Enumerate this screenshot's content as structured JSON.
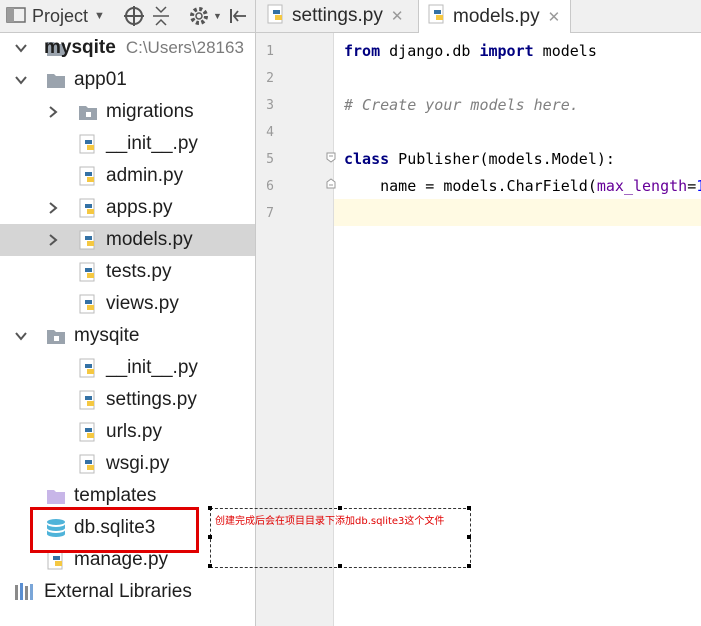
{
  "project_panel": {
    "switcher_label": "Project",
    "toolbar_icons": [
      "target-icon",
      "collapse-all-icon",
      "gear-icon",
      "hide-panel-icon"
    ]
  },
  "tree": [
    {
      "label": "mysqite",
      "path": "C:\\Users\\28163",
      "type": "project",
      "bold": true
    },
    {
      "label": "app01",
      "type": "folder",
      "expanded": true
    },
    {
      "label": "migrations",
      "type": "package",
      "expanded": false
    },
    {
      "label": "__init__.py",
      "type": "python"
    },
    {
      "label": "admin.py",
      "type": "python"
    },
    {
      "label": "apps.py",
      "type": "python",
      "expanded": false
    },
    {
      "label": "models.py",
      "type": "python",
      "expanded": false,
      "selected": true
    },
    {
      "label": "tests.py",
      "type": "python"
    },
    {
      "label": "views.py",
      "type": "python"
    },
    {
      "label": "mysqite",
      "type": "folder",
      "expanded": true
    },
    {
      "label": "__init__.py",
      "type": "python"
    },
    {
      "label": "settings.py",
      "type": "python"
    },
    {
      "label": "urls.py",
      "type": "python"
    },
    {
      "label": "wsgi.py",
      "type": "python"
    },
    {
      "label": "templates",
      "type": "template-folder"
    },
    {
      "label": "db.sqlite3",
      "type": "database"
    },
    {
      "label": "manage.py",
      "type": "python"
    },
    {
      "label": "External Libraries",
      "type": "libraries"
    }
  ],
  "tabs": [
    {
      "label": "settings.py",
      "close": "✕",
      "active": false
    },
    {
      "label": "models.py",
      "close": "✕",
      "active": true
    }
  ],
  "editor": {
    "line_numbers": [
      "1",
      "2",
      "3",
      "4",
      "5",
      "6",
      "7"
    ],
    "current_line": 7,
    "lines": [
      "from django.db import models",
      "",
      "# Create your models here.",
      "",
      "class Publisher(models.Model):",
      "    name = models.CharField(max_length=1",
      ""
    ]
  },
  "annotation": {
    "note": "创建完成后会在项目目录下添加db.sqlite3这个文件",
    "highlight_color": "#e00000"
  },
  "colors": {
    "keyword": "#000080",
    "comment": "#808080",
    "param": "#660099",
    "number": "#0000ff",
    "selection": "#d5d5d5",
    "current_line": "#fffae3"
  }
}
